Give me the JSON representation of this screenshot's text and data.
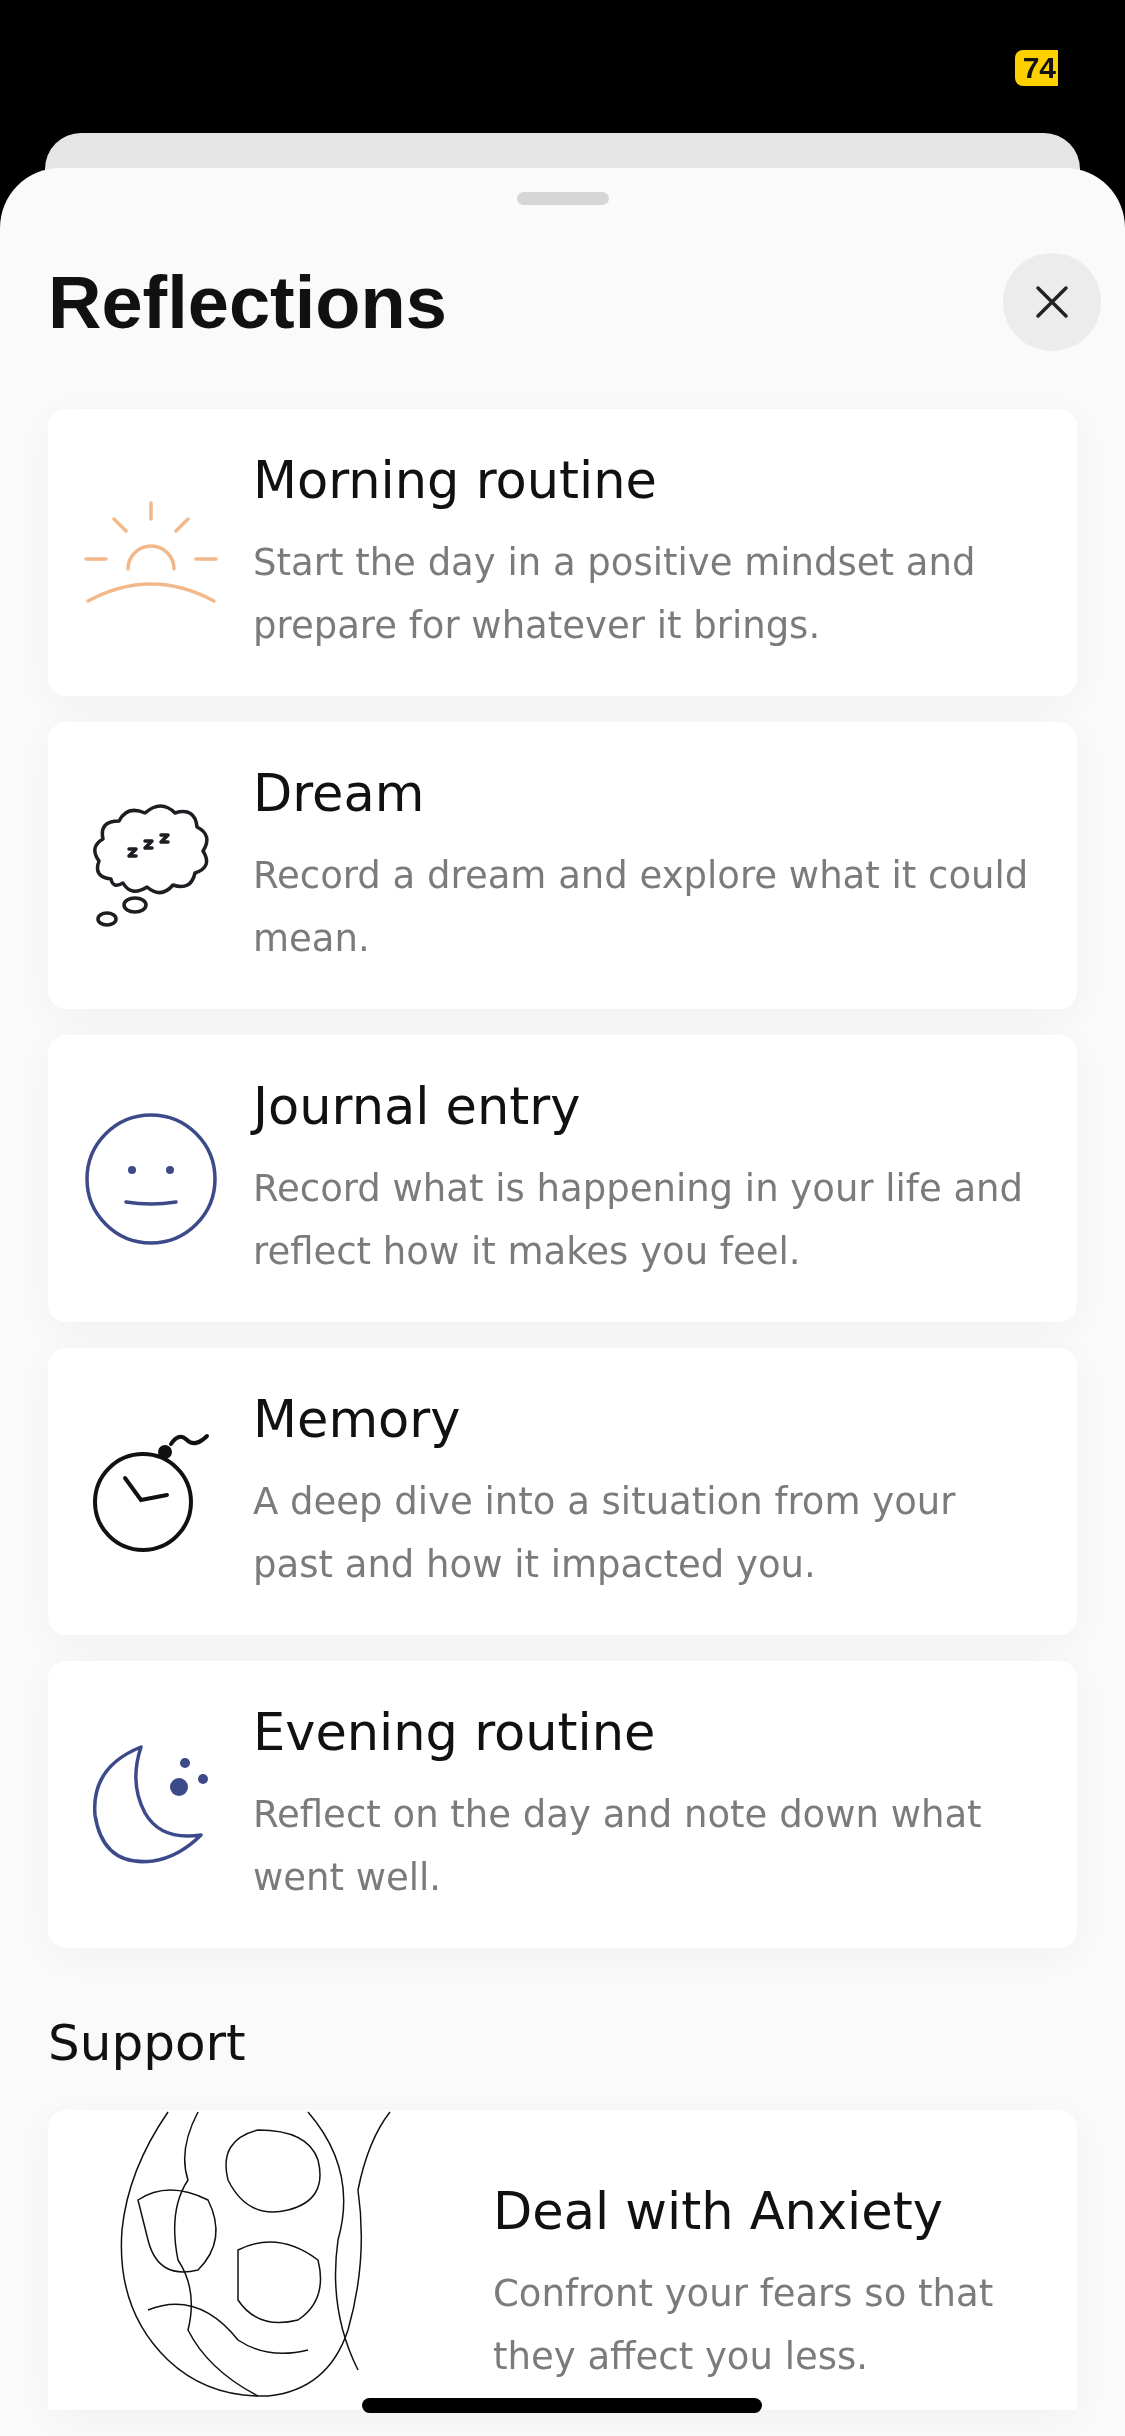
{
  "status_bar": {
    "battery": "74"
  },
  "sheet": {
    "title": "Reflections"
  },
  "reflections": [
    {
      "title": "Morning routine",
      "description": "Start the day in a positive mindset and prepare for whatever it brings."
    },
    {
      "title": "Dream",
      "description": "Record a dream and explore what it could mean."
    },
    {
      "title": "Journal entry",
      "description": "Record what is happening in your life and reflect how it makes you feel."
    },
    {
      "title": "Memory",
      "description": "A deep dive into a situation from your past and how it impacted you."
    },
    {
      "title": "Evening routine",
      "description": "Reflect on the day and note down what went well."
    }
  ],
  "support": {
    "heading": "Support",
    "items": [
      {
        "title": "Deal with Anxiety",
        "description": "Confront your fears so that they affect you less."
      }
    ]
  }
}
